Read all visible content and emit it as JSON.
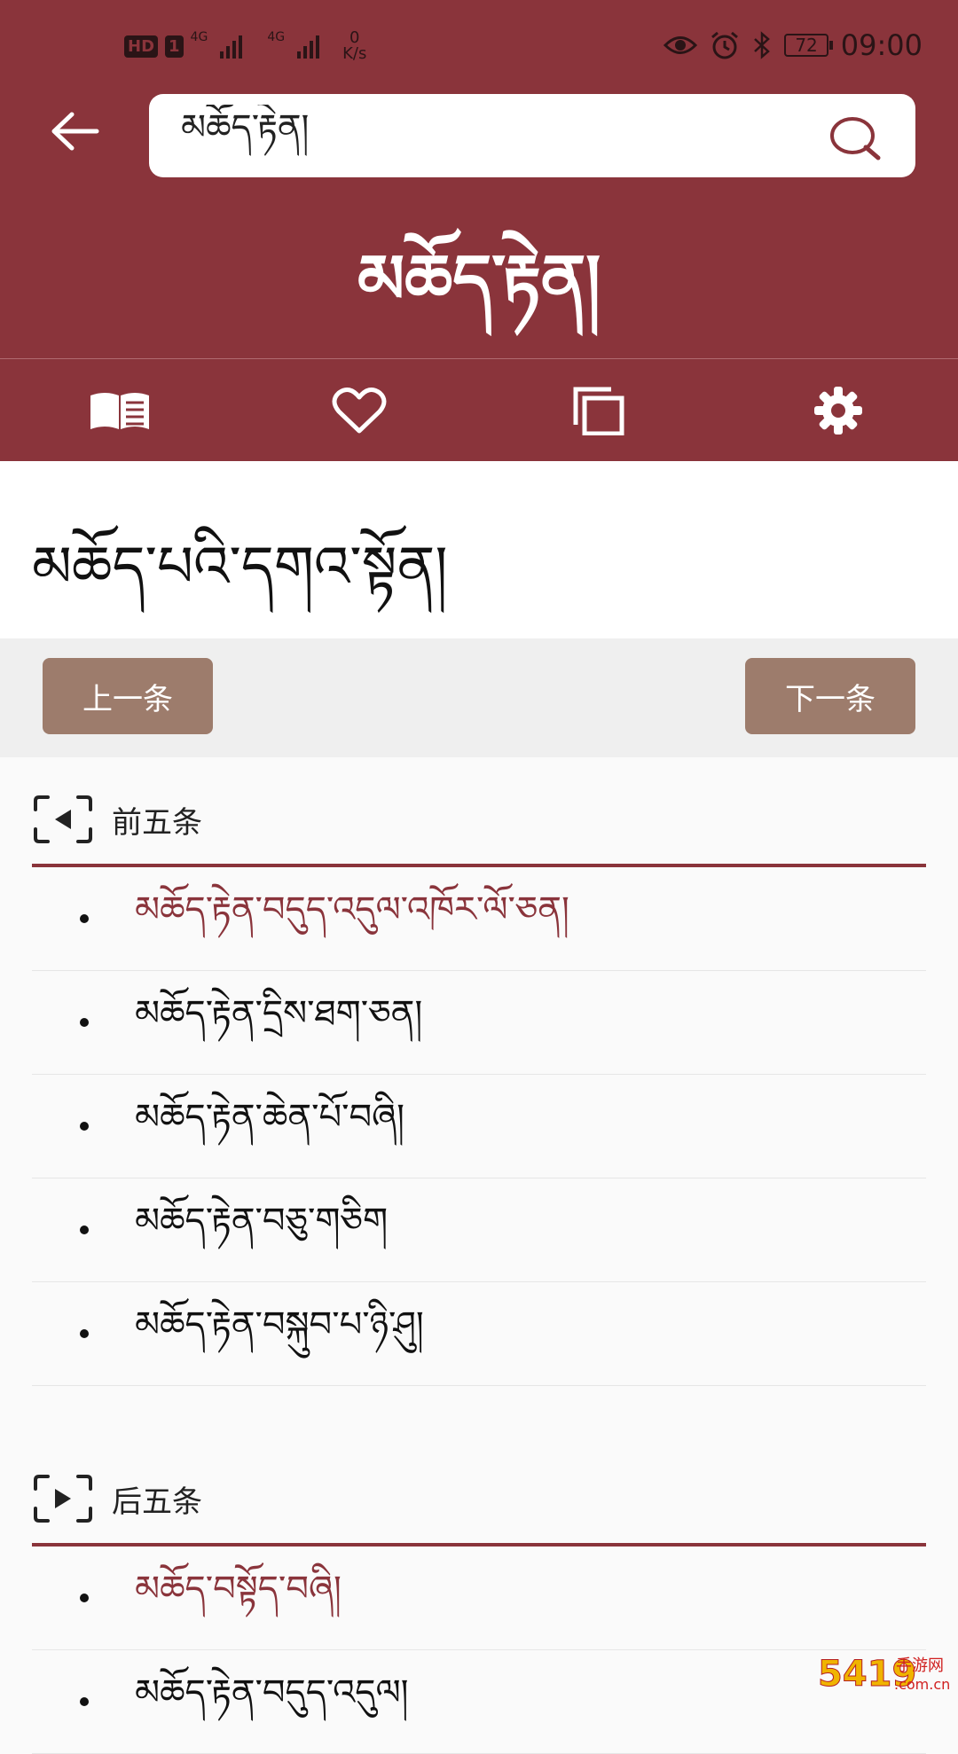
{
  "status_bar": {
    "hd": "HD",
    "sim": "1",
    "net1": "4G",
    "net2": "4G",
    "speed_value": "0",
    "speed_unit": "K/s",
    "battery": "72",
    "time": "09:00"
  },
  "search": {
    "query": "མཆོད་རྟེན།"
  },
  "word": {
    "title": "མཆོད་རྟེན།",
    "headword": "མཆོད་པའི་དགའ་སྟོན།"
  },
  "toolbar_icons": [
    "book-icon",
    "heart-icon",
    "copy-icon",
    "settings-icon"
  ],
  "navigation": {
    "prev_label": "上一条",
    "next_label": "下一条"
  },
  "previous_five": {
    "label": "前五条",
    "items": [
      "མཆོད་རྟེན་བདུད་འདུལ་འཁོར་ལོ་ཅན།",
      "མཆོད་རྟེན་དྲིས་ཐག་ཅན།",
      "མཆོད་རྟེན་ཆེན་པོ་བཞི།",
      "མཆོད་རྟེན་བཅུ་གཅིག",
      "མཆོད་རྟེན་བསྐུབ་པ་ཉི་ཤུ།"
    ]
  },
  "next_five": {
    "label": "后五条",
    "items": [
      "མཆོད་བསྟོད་བཞི།",
      "མཆོད་རྟེན་བདུད་འདུལ།"
    ]
  },
  "colors": {
    "brand": "#8a343b",
    "nav_button": "#9d7c6c",
    "accent_text": "#8a343b"
  },
  "watermark": {
    "text": "5419",
    "domain": "手游网",
    "suffix": ".com.cn"
  }
}
